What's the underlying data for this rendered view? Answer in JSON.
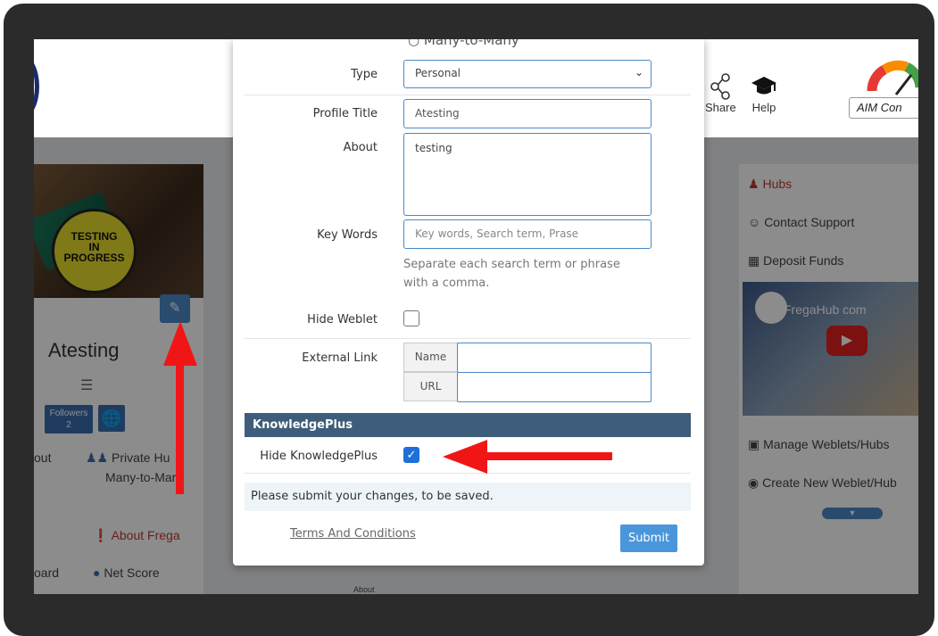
{
  "header": {
    "share_label": "Share",
    "help_label": "Help",
    "aim_label": "AIM Con"
  },
  "profile": {
    "badge_text_line1": "TESTING",
    "badge_text_line2": "IN",
    "badge_text_line3": "PROGRESS",
    "name": "Atesting",
    "followers_label": "Followers",
    "followers_count": "2",
    "about_partial": "out",
    "private_hub": "Private Hu",
    "hub_type": "Many-to-Mar",
    "about_frega": "About Frega",
    "board_partial": "oard",
    "net_score": "Net Score",
    "about_small": "About"
  },
  "right_sidebar": {
    "hubs": "Hubs",
    "contact_support": "Contact Support",
    "deposit_funds": "Deposit Funds",
    "video_title": "FregaHub com",
    "manage_weblets": "Manage Weblets/Hubs",
    "create_weblet": "Create New Weblet/Hub"
  },
  "modal": {
    "top_radio_label": "Many-to-Many",
    "type_label": "Type",
    "type_value": "Personal",
    "profile_title_label": "Profile Title",
    "profile_title_value": "Atesting",
    "about_label": "About",
    "about_value": "testing",
    "key_words_label": "Key Words",
    "key_words_placeholder": "Key words, Search term, Prase",
    "key_words_hint": "Separate each search term or phrase with a comma.",
    "hide_weblet_label": "Hide Weblet",
    "external_link_label": "External Link",
    "name_addon": "Name",
    "url_addon": "URL",
    "section_title": "KnowledgePlus",
    "hide_knowledgeplus_label": "Hide KnowledgePlus",
    "notice": "Please submit your changes, to be saved.",
    "terms_link": "Terms And Conditions",
    "submit_label": "Submit"
  },
  "colors": {
    "accent": "#4a89c9",
    "section_bar": "#3e5d7a",
    "arrow": "#f11616",
    "checkbox_checked": "#1e6fd9"
  }
}
